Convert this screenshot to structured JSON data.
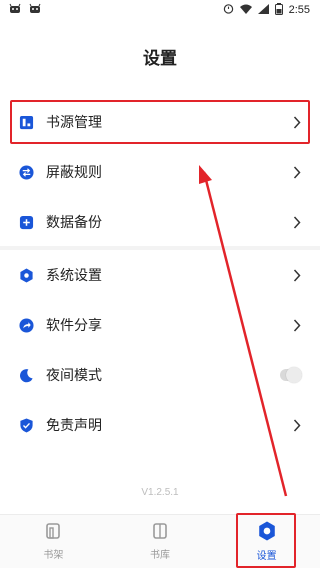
{
  "status_bar": {
    "time": "2:55",
    "left_icons": [
      "android-notification-icon",
      "android-notification-icon"
    ],
    "right_icons": [
      "alarm-icon",
      "wifi-icon",
      "signal-icon",
      "battery-icon"
    ]
  },
  "page": {
    "title": "设置"
  },
  "menu_group_1": [
    {
      "label": "书源管理",
      "icon": "book-source-icon",
      "icon_color": "#1a56d8",
      "trailing": "chevron"
    },
    {
      "label": "屏蔽规则",
      "icon": "swap-icon",
      "icon_color": "#1a56d8",
      "trailing": "chevron"
    },
    {
      "label": "数据备份",
      "icon": "add-backup-icon",
      "icon_color": "#1a56d8",
      "trailing": "chevron"
    }
  ],
  "menu_group_2": [
    {
      "label": "系统设置",
      "icon": "hexagon-settings-icon",
      "icon_color": "#1a56d8",
      "trailing": "chevron"
    },
    {
      "label": "软件分享",
      "icon": "share-icon",
      "icon_color": "#1a56d8",
      "trailing": "chevron"
    },
    {
      "label": "夜间模式",
      "icon": "moon-icon",
      "icon_color": "#1a56d8",
      "trailing": "toggle",
      "toggle_on": false
    },
    {
      "label": "免责声明",
      "icon": "shield-check-icon",
      "icon_color": "#1a56d8",
      "trailing": "chevron"
    }
  ],
  "version": "V1.2.5.1",
  "bottom_nav": [
    {
      "label": "书架",
      "icon": "bookshelf-icon",
      "active": false
    },
    {
      "label": "书库",
      "icon": "library-icon",
      "active": false
    },
    {
      "label": "设置",
      "icon": "settings-icon",
      "active": true
    }
  ],
  "colors": {
    "accent": "#1a56d8",
    "annotation": "#e2242a"
  }
}
